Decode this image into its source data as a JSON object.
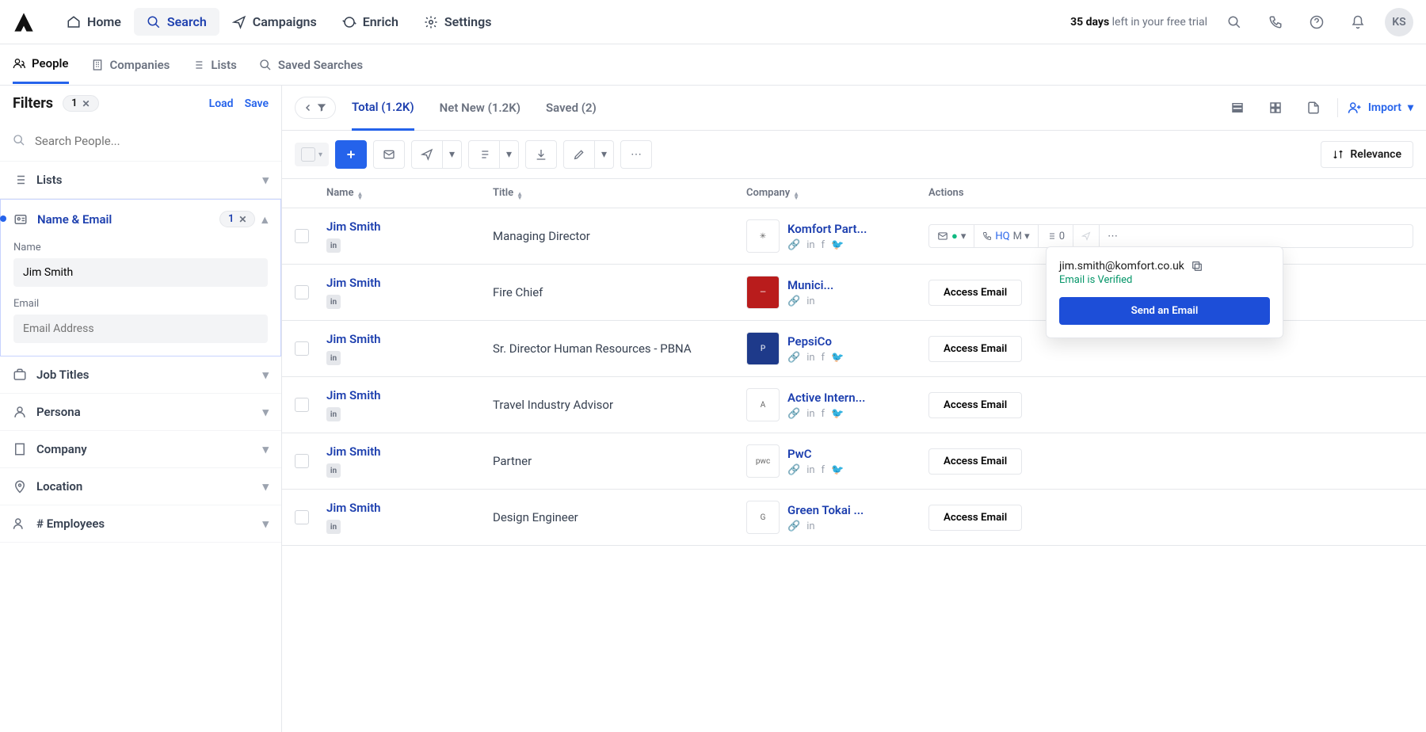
{
  "topnav": {
    "items": [
      {
        "label": "Home"
      },
      {
        "label": "Search"
      },
      {
        "label": "Campaigns"
      },
      {
        "label": "Enrich"
      },
      {
        "label": "Settings"
      }
    ],
    "trial_days": "35 days",
    "trial_rest": " left in your free trial",
    "avatar": "KS"
  },
  "subnav": {
    "items": [
      {
        "label": "People"
      },
      {
        "label": "Companies"
      },
      {
        "label": "Lists"
      },
      {
        "label": "Saved Searches"
      }
    ]
  },
  "filters": {
    "title": "Filters",
    "count": "1",
    "load": "Load",
    "save": "Save",
    "search_placeholder": "Search People...",
    "groups": {
      "lists": "Lists",
      "name_email": "Name & Email",
      "name_email_badge": "1",
      "name_label": "Name",
      "name_value": "Jim Smith",
      "email_label": "Email",
      "email_placeholder": "Email Address",
      "job_titles": "Job Titles",
      "persona": "Persona",
      "company": "Company",
      "location": "Location",
      "employees": "# Employees"
    }
  },
  "tabs": [
    {
      "label": "Total (1.2K)"
    },
    {
      "label": "Net New (1.2K)"
    },
    {
      "label": "Saved (2)"
    }
  ],
  "import_label": "Import",
  "sort_label": "Relevance",
  "columns": {
    "name": "Name",
    "title": "Title",
    "company": "Company",
    "actions": "Actions"
  },
  "popover": {
    "email": "jim.smith@komfort.co.uk",
    "verified": "Email is Verified",
    "send": "Send an Email"
  },
  "row_action": {
    "hq": "HQ",
    "m": "M",
    "zero": "0"
  },
  "access_email": "Access Email",
  "rows": [
    {
      "name": "Jim Smith",
      "title": "Managing Director",
      "company": "Komfort Part...",
      "logo": "✳",
      "logo_bg": "#fff",
      "social": [
        "link",
        "in",
        "fb",
        "tw"
      ],
      "special": true
    },
    {
      "name": "Jim Smith",
      "title": "Fire Chief",
      "company": "Munici...",
      "logo": "—",
      "logo_bg": "#b91c1c",
      "social": [
        "link",
        "in"
      ]
    },
    {
      "name": "Jim Smith",
      "title": "Sr. Director Human Resources - PBNA",
      "company": "PepsiCo",
      "logo": "P",
      "logo_bg": "#1e3a8a",
      "social": [
        "link",
        "in",
        "fb",
        "tw"
      ]
    },
    {
      "name": "Jim Smith",
      "title": "Travel Industry Advisor",
      "company": "Active Intern...",
      "logo": "A",
      "logo_bg": "#fff",
      "social": [
        "link",
        "in",
        "fb",
        "tw"
      ]
    },
    {
      "name": "Jim Smith",
      "title": "Partner",
      "company": "PwC",
      "logo": "pwc",
      "logo_bg": "#fff",
      "social": [
        "link",
        "in",
        "fb",
        "tw"
      ]
    },
    {
      "name": "Jim Smith",
      "title": "Design Engineer",
      "company": "Green Tokai ...",
      "logo": "G",
      "logo_bg": "#fff",
      "social": [
        "link",
        "in"
      ]
    }
  ]
}
